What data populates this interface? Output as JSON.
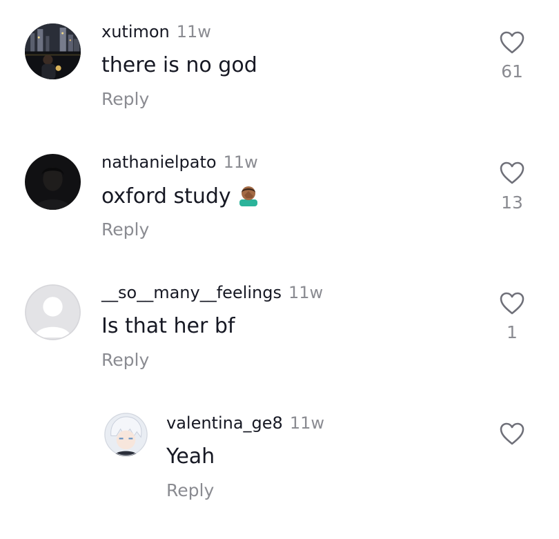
{
  "comments": [
    {
      "username": "xutimon",
      "time": "11w",
      "text": "there is no god",
      "reply_label": "Reply",
      "likes": "61",
      "avatar_icon": "city-night-photo-avatar"
    },
    {
      "username": "nathanielpato",
      "time": "11w",
      "text": "oxford study",
      "emoji_icon": "facepalm-emoji",
      "reply_label": "Reply",
      "likes": "13",
      "avatar_icon": "dark-selfie-avatar"
    },
    {
      "username": "__so__many__feelings",
      "time": "11w",
      "text": "Is that her bf",
      "reply_label": "Reply",
      "likes": "1",
      "avatar_icon": "default-user-avatar"
    },
    {
      "username": "valentina_ge8",
      "time": "11w",
      "text": "Yeah",
      "reply_label": "Reply",
      "likes": "",
      "avatar_icon": "anime-character-avatar",
      "is_reply": true
    }
  ],
  "colors": {
    "text": "#161823",
    "muted": "#8a8b91",
    "default_avatar_bg": "#e3e3e6"
  }
}
